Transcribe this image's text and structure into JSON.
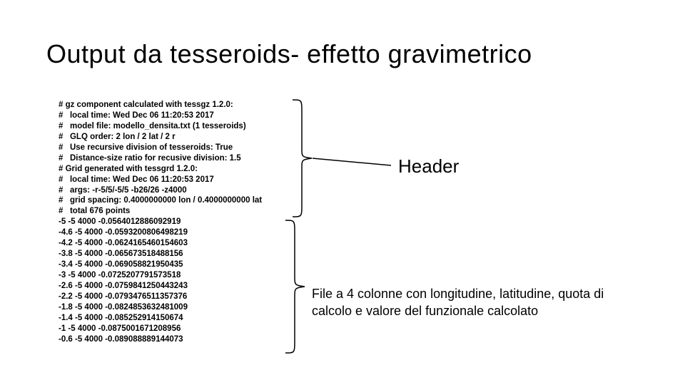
{
  "title": "Output da tesseroids- effetto gravimetrico",
  "code_lines": [
    "# gz component calculated with tessgz 1.2.0:",
    "#   local time: Wed Dec 06 11:20:53 2017",
    "#   model file: modello_densita.txt (1 tesseroids)",
    "#   GLQ order: 2 lon / 2 lat / 2 r",
    "#   Use recursive division of tesseroids: True",
    "#   Distance-size ratio for recusive division: 1.5",
    "# Grid generated with tessgrd 1.2.0:",
    "#   local time: Wed Dec 06 11:20:53 2017",
    "#   args: -r-5/5/-5/5 -b26/26 -z4000",
    "#   grid spacing: 0.4000000000 lon / 0.4000000000 lat",
    "#   total 676 points",
    "-5 -5 4000 -0.0564012886092919",
    "-4.6 -5 4000 -0.0593200806498219",
    "-4.2 -5 4000 -0.0624165460154603",
    "-3.8 -5 4000 -0.065673518488156",
    "-3.4 -5 4000 -0.069058821950435",
    "-3 -5 4000 -0.0725207791573518",
    "-2.6 -5 4000 -0.0759841250443243",
    "-2.2 -5 4000 -0.0793476511357376",
    "-1.8 -5 4000 -0.0824853632481009",
    "-1.4 -5 4000 -0.085252914150674",
    "-1 -5 4000 -0.0875001671208956",
    "-0.6 -5 4000 -0.089088889144073"
  ],
  "labels": {
    "header": "Header",
    "description": "File a 4 colonne con longitudine, latitudine, quota di calcolo e valore del funzionale calcolato"
  }
}
